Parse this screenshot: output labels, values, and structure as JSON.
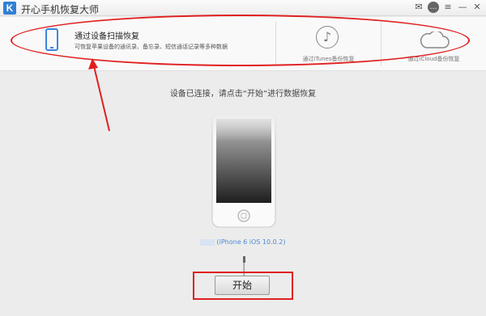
{
  "window": {
    "logo_letter": "K",
    "title": "开心手机恢复大师"
  },
  "window_controls": [
    {
      "icon": "wechat-icon",
      "glyph": "✉"
    },
    {
      "icon": "chat-icon",
      "glyph": "…"
    },
    {
      "icon": "menu-icon",
      "glyph": "≡"
    },
    {
      "icon": "minimize-icon",
      "glyph": "—"
    },
    {
      "icon": "close-icon",
      "glyph": "✕"
    }
  ],
  "options": {
    "device_scan": {
      "icon": "phone-icon",
      "title": "通过设备扫描恢复",
      "desc": "可恢复苹果设备的通讯录、备忘录、短信通话记录等多种数据"
    },
    "itunes": {
      "icon": "music-note-icon",
      "label": "通过iTunes备份恢复"
    },
    "icloud": {
      "icon": "cloud-icon",
      "label": "通过iCloud备份恢复"
    }
  },
  "main": {
    "instruction": "设备已连接，请点击“开始”进行数据恢复",
    "device_info": "(iPhone 6 iOS 10.0.2)",
    "start_label": "开始"
  },
  "colors": {
    "accent": "#3b86e0",
    "annotation": "#e02020"
  }
}
